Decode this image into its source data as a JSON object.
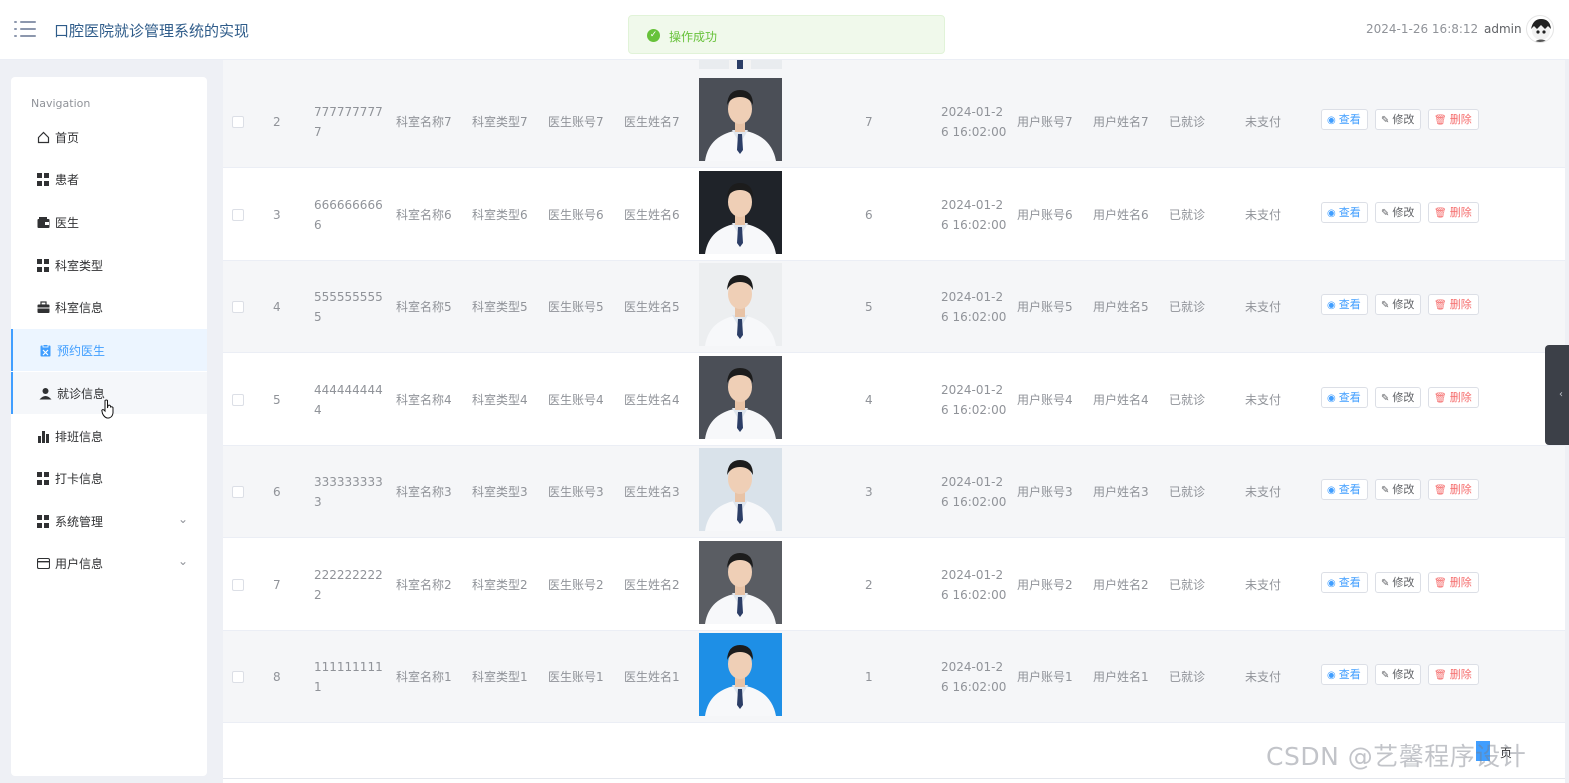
{
  "header": {
    "title": "口腔医院就诊管理系统的实现",
    "datetime": "2024-1-26 16:8:12",
    "username": "admin"
  },
  "toast": {
    "message": "操作成功",
    "color": "#67c23a"
  },
  "sidebar": {
    "heading": "Navigation",
    "accent": "#409eff",
    "items": [
      {
        "label": "首页",
        "icon": "home-icon"
      },
      {
        "label": "患者",
        "icon": "grid-icon"
      },
      {
        "label": "医生",
        "icon": "wallet-icon"
      },
      {
        "label": "科室类型",
        "icon": "grid-icon"
      },
      {
        "label": "科室信息",
        "icon": "briefcase-icon"
      },
      {
        "label": "预约医生",
        "icon": "clipboard-icon",
        "state": "active"
      },
      {
        "label": "就诊信息",
        "icon": "user-icon",
        "state": "hover"
      },
      {
        "label": "排班信息",
        "icon": "bar-chart-icon"
      },
      {
        "label": "打卡信息",
        "icon": "grid-icon"
      },
      {
        "label": "系统管理",
        "icon": "grid-icon",
        "expandable": true
      },
      {
        "label": "用户信息",
        "icon": "card-icon",
        "expandable": true
      }
    ]
  },
  "table": {
    "rows": [
      {
        "index": "2",
        "appt_no": "777777777\n7",
        "dept_name": "科室名称7",
        "dept_type": "科室类型7",
        "doctor_account": "医生账号7",
        "doctor_name": "医生姓名7",
        "count": "7",
        "time": "2024-01-2\n6 16:02:00",
        "user_account": "用户账号7",
        "user_name": "用户姓名7",
        "visit_status": "已就诊",
        "pay_status": "未支付",
        "photo_bg": "#4b4f57"
      },
      {
        "index": "3",
        "appt_no": "666666666\n6",
        "dept_name": "科室名称6",
        "dept_type": "科室类型6",
        "doctor_account": "医生账号6",
        "doctor_name": "医生姓名6",
        "count": "6",
        "time": "2024-01-2\n6 16:02:00",
        "user_account": "用户账号6",
        "user_name": "用户姓名6",
        "visit_status": "已就诊",
        "pay_status": "未支付",
        "photo_bg": "#1f2329"
      },
      {
        "index": "4",
        "appt_no": "555555555\n5",
        "dept_name": "科室名称5",
        "dept_type": "科室类型5",
        "doctor_account": "医生账号5",
        "doctor_name": "医生姓名5",
        "count": "5",
        "time": "2024-01-2\n6 16:02:00",
        "user_account": "用户账号5",
        "user_name": "用户姓名5",
        "visit_status": "已就诊",
        "pay_status": "未支付",
        "photo_bg": "#eceef0"
      },
      {
        "index": "5",
        "appt_no": "444444444\n4",
        "dept_name": "科室名称4",
        "dept_type": "科室类型4",
        "doctor_account": "医生账号4",
        "doctor_name": "医生姓名4",
        "count": "4",
        "time": "2024-01-2\n6 16:02:00",
        "user_account": "用户账号4",
        "user_name": "用户姓名4",
        "visit_status": "已就诊",
        "pay_status": "未支付",
        "photo_bg": "#4b4f57"
      },
      {
        "index": "6",
        "appt_no": "333333333\n3",
        "dept_name": "科室名称3",
        "dept_type": "科室类型3",
        "doctor_account": "医生账号3",
        "doctor_name": "医生姓名3",
        "count": "3",
        "time": "2024-01-2\n6 16:02:00",
        "user_account": "用户账号3",
        "user_name": "用户姓名3",
        "visit_status": "已就诊",
        "pay_status": "未支付",
        "photo_bg": "#d9e2ea"
      },
      {
        "index": "7",
        "appt_no": "222222222\n2",
        "dept_name": "科室名称2",
        "dept_type": "科室类型2",
        "doctor_account": "医生账号2",
        "doctor_name": "医生姓名2",
        "count": "2",
        "time": "2024-01-2\n6 16:02:00",
        "user_account": "用户账号2",
        "user_name": "用户姓名2",
        "visit_status": "已就诊",
        "pay_status": "未支付",
        "photo_bg": "#5a5d63"
      },
      {
        "index": "8",
        "appt_no": "111111111\n1",
        "dept_name": "科室名称1",
        "dept_type": "科室类型1",
        "doctor_account": "医生账号1",
        "doctor_name": "医生姓名1",
        "count": "1",
        "time": "2024-01-2\n6 16:02:00",
        "user_account": "用户账号1",
        "user_name": "用户姓名1",
        "visit_status": "已就诊",
        "pay_status": "未支付",
        "photo_bg": "#1e8fe6"
      }
    ],
    "actions": {
      "view": "查看",
      "edit": "修改",
      "delete": "删除"
    }
  },
  "watermark": "CSDN @艺馨程序设计",
  "pager_label": "页"
}
